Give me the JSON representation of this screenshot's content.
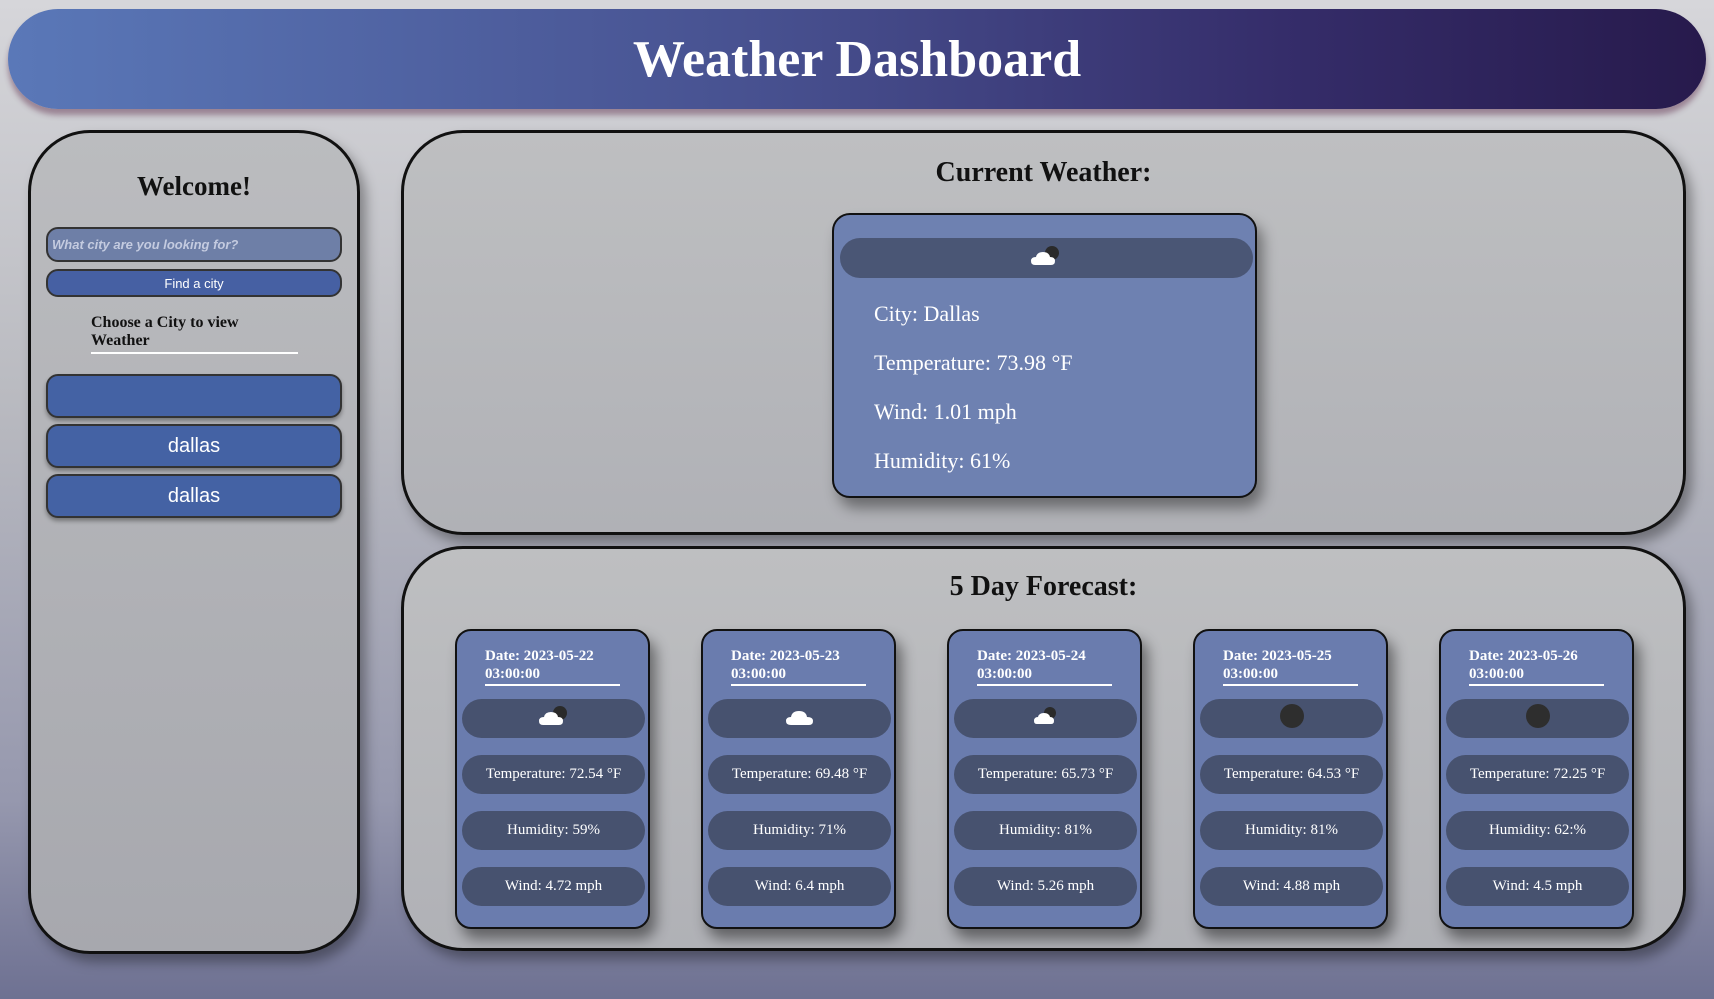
{
  "header": {
    "title": "Weather Dashboard"
  },
  "sidebar": {
    "welcome": "Welcome!",
    "search_placeholder": "What city are you looking for?",
    "search_value": "",
    "find_label": "Find a city",
    "choose_label": "Choose a City to view Weather",
    "cities": [
      "",
      "dallas",
      "dallas"
    ]
  },
  "current": {
    "title": "Current Weather:",
    "icon": "cloud-sun-icon",
    "city": "City: Dallas",
    "temperature": "Temperature: 73.98 °F",
    "wind": "Wind: 1.01 mph",
    "humidity": "Humidity: 61%"
  },
  "forecast": {
    "title": "5 Day Forecast:",
    "days": [
      {
        "date": "Date: 2023-05-22 03:00:00",
        "icon": "cloud-moon-icon",
        "temperature": "Temperature: 72.54 °F",
        "humidity": "Humidity: 59%",
        "wind": "Wind: 4.72 mph"
      },
      {
        "date": "Date: 2023-05-23 03:00:00",
        "icon": "cloud-icon",
        "temperature": "Temperature: 69.48 °F",
        "humidity": "Humidity: 71%",
        "wind": "Wind: 6.4 mph"
      },
      {
        "date": "Date: 2023-05-24 03:00:00",
        "icon": "cloud-moon-icon",
        "temperature": "Temperature: 65.73 °F",
        "humidity": "Humidity: 81%",
        "wind": "Wind: 5.26 mph"
      },
      {
        "date": "Date: 2023-05-25 03:00:00",
        "icon": "moon-icon",
        "temperature": "Temperature: 64.53 °F",
        "humidity": "Humidity: 81%",
        "wind": "Wind: 4.88 mph"
      },
      {
        "date": "Date: 2023-05-26 03:00:00",
        "icon": "moon-icon",
        "temperature": "Temperature: 72.25 °F",
        "humidity": "Humidity: 62:%",
        "wind": "Wind: 4.5 mph"
      }
    ]
  }
}
